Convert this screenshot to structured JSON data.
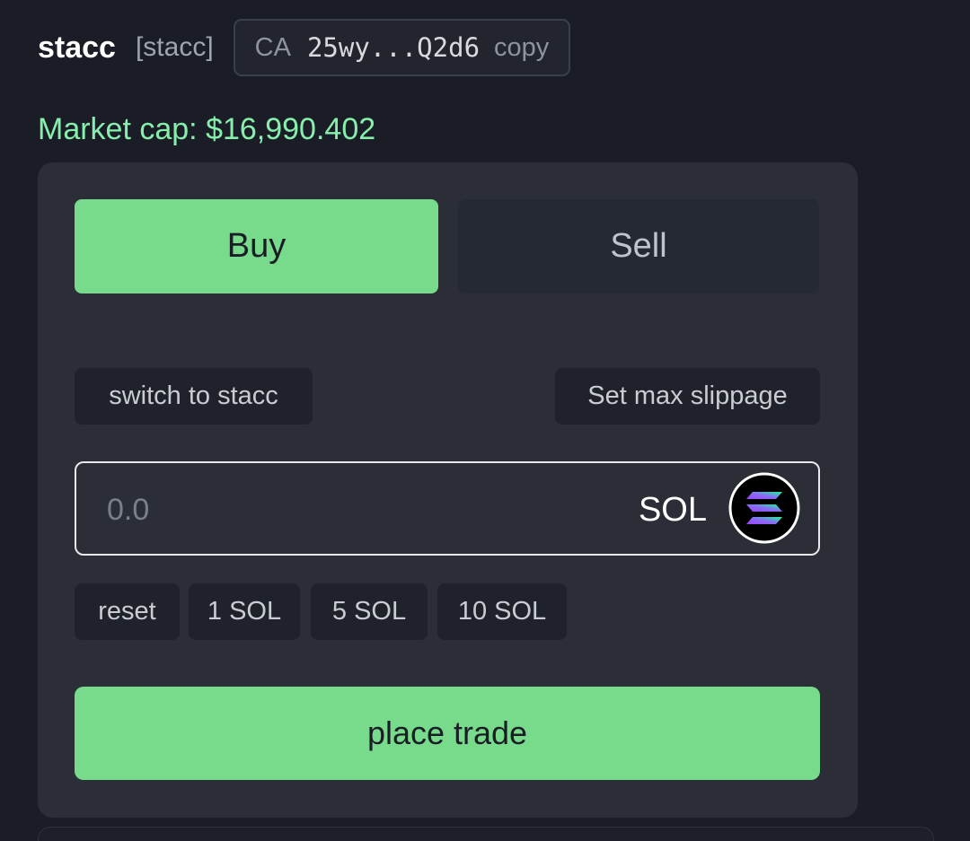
{
  "header": {
    "token_name": "stacc",
    "ticker": "[stacc]",
    "ca": {
      "label": "CA",
      "value": "25wy...Q2d6",
      "copy_label": "copy"
    }
  },
  "market_cap": "Market cap: $16,990.402",
  "trade": {
    "tabs": {
      "buy": "Buy",
      "sell": "Sell"
    },
    "active_tab": "Buy",
    "switch_label": "switch to stacc",
    "slippage_label": "Set max slippage",
    "amount": {
      "value": "",
      "placeholder": "0.0",
      "currency": "SOL",
      "currency_icon": "solana-logo-icon"
    },
    "quick_amounts": [
      "reset",
      "1 SOL",
      "5 SOL",
      "10 SOL"
    ],
    "submit_label": "place trade"
  },
  "colors": {
    "background": "#1b1d26",
    "card": "#2b2e37",
    "accent_green": "#77db8b",
    "market_cap_green": "#86efac"
  }
}
